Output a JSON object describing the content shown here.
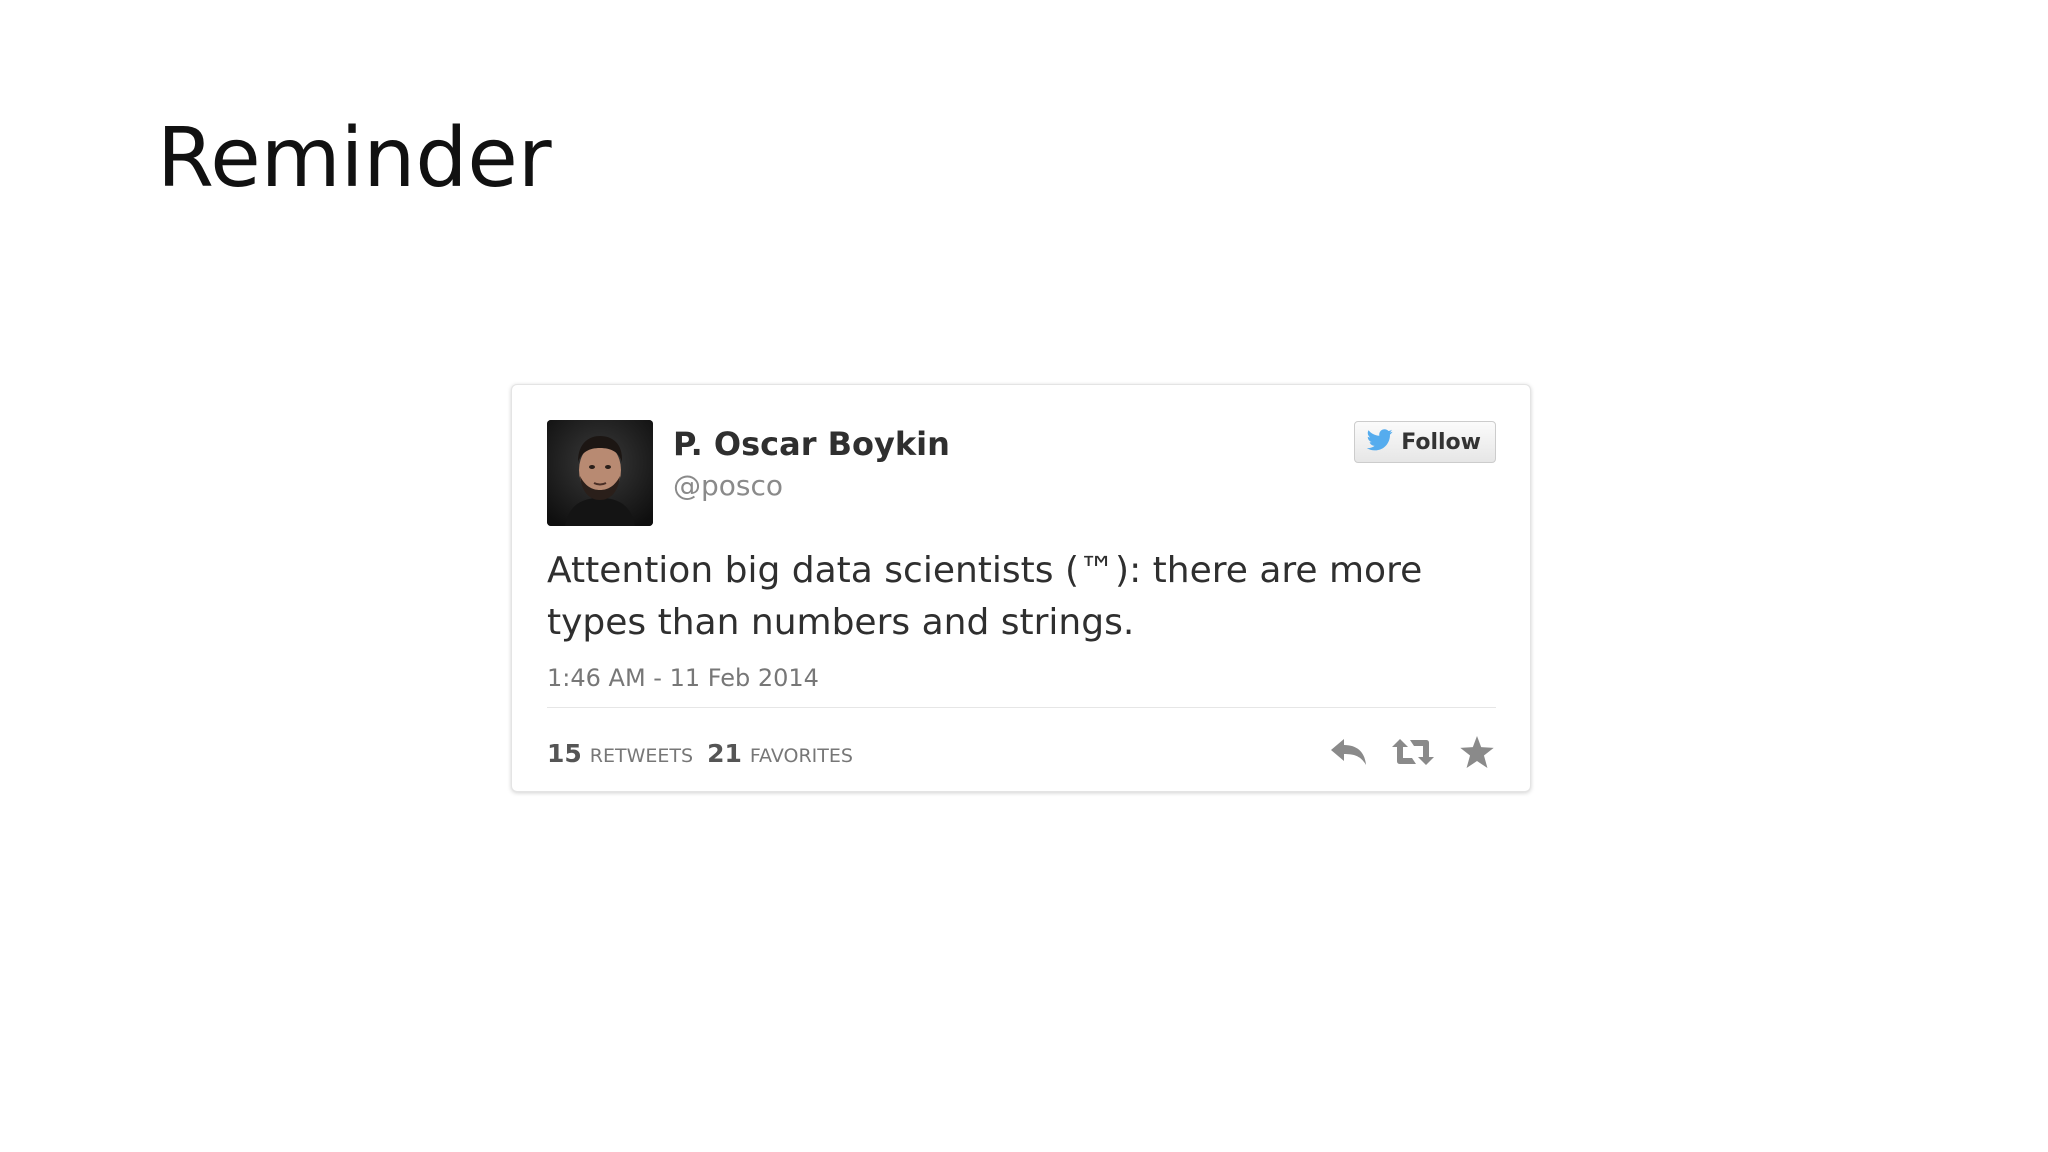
{
  "slide": {
    "title": "Reminder"
  },
  "tweet": {
    "author_name": "P. Oscar Boykin",
    "author_handle": "@posco",
    "follow_label": "Follow",
    "text": "Attention big data scientists (™): there are more types than numbers and strings.",
    "timestamp": "1:46 AM - 11 Feb 2014",
    "retweets_count": "15",
    "retweets_label": "Retweets",
    "favorites_count": "21",
    "favorites_label": "Favorites"
  },
  "icons": {
    "follow": "twitter-bird-icon",
    "reply": "reply-icon",
    "retweet": "retweet-icon",
    "favorite": "star-icon",
    "avatar": "user-photo"
  },
  "colors": {
    "twitter_blue": "#55acee",
    "action_gray": "#8a8a8a",
    "text_dark": "#2f2f2f",
    "text_muted": "#777777"
  }
}
